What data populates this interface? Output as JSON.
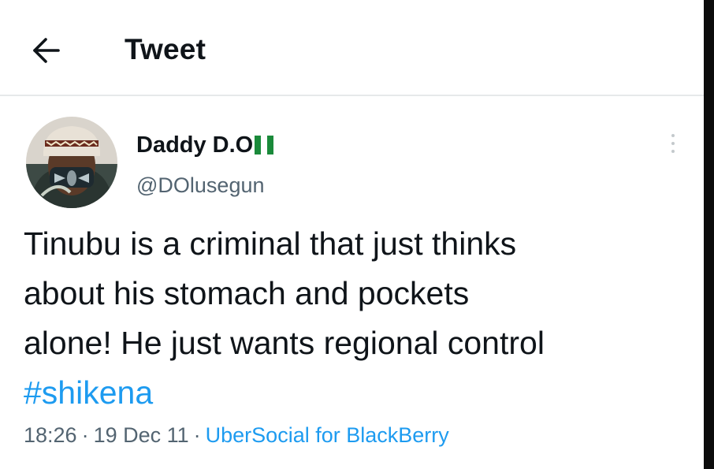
{
  "header": {
    "back_icon": "arrow-left-icon",
    "title": "Tweet"
  },
  "tweet": {
    "author": {
      "display_name": "Daddy D.O",
      "flag_icon": "nigeria-flag-icon",
      "handle": "@DOlusegun",
      "avatar_icon": "avatar-image"
    },
    "more_icon": "more-vertical-icon",
    "text_lines": [
      "Tinubu is a criminal that just thinks",
      "about his stomach and pockets",
      "alone! He just wants regional control"
    ],
    "hashtag": "#shikena",
    "time": "18:26",
    "date": "19 Dec 11",
    "separator": "·",
    "source": "UberSocial for BlackBerry"
  },
  "colors": {
    "text_primary": "#0f1419",
    "text_secondary": "#536471",
    "link": "#1d9bf0",
    "flag_green": "#1a8a3a",
    "divider": "#e6e9ea"
  }
}
